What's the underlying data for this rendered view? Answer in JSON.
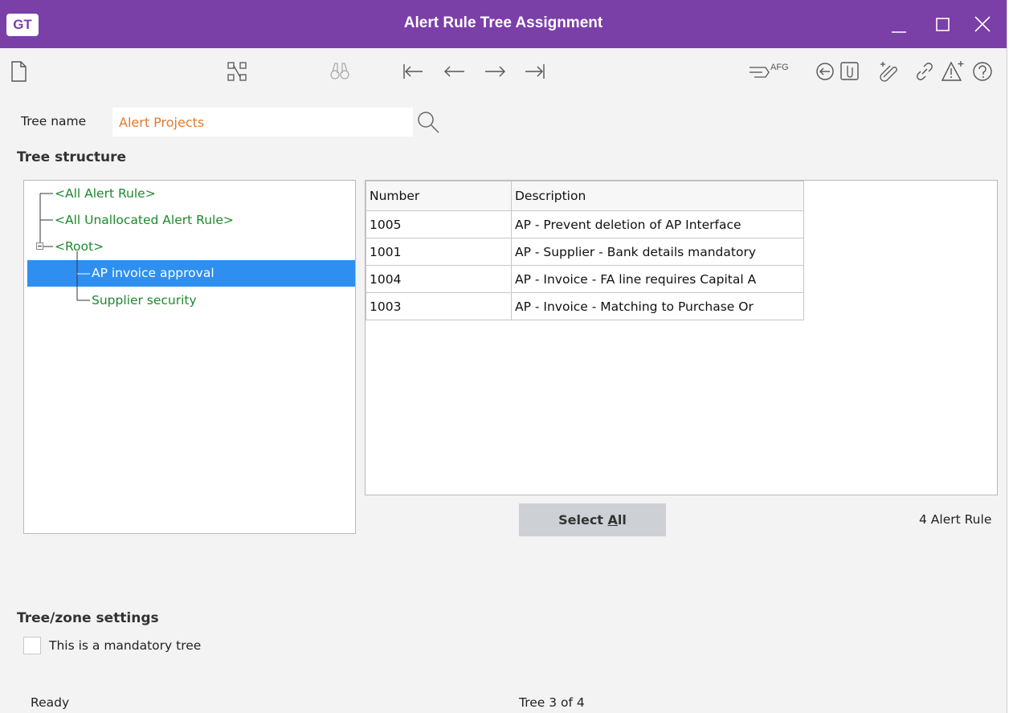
{
  "window": {
    "logo_text": "GT",
    "title": "Alert Rule Tree Assignment",
    "accent_color": "#7b3fa8"
  },
  "toolbar": {
    "left_icons": [
      "new-document-icon",
      "tree-structure-icon",
      "binoculars-icon",
      "first-record-icon",
      "previous-record-icon",
      "next-record-icon",
      "last-record-icon"
    ],
    "afg_label": "AFG",
    "right_icons": [
      "flag-pointer-icon",
      "afg-icon",
      "back-circle-icon",
      "attachment-folder-icon",
      "add-attachment-icon",
      "link-icon",
      "alert-add-icon",
      "help-icon"
    ]
  },
  "form": {
    "tree_name_label": "Tree name",
    "tree_name_value": "Alert Projects"
  },
  "tree_structure": {
    "heading": "Tree structure",
    "nodes": [
      {
        "label": "<All Alert Rule>"
      },
      {
        "label": "<All Unallocated Alert Rule>"
      },
      {
        "label": "<Root>"
      },
      {
        "label": "AP invoice approval",
        "selected": true
      },
      {
        "label": "Supplier security"
      }
    ],
    "node_color": "#1c8a2e",
    "selection_color": "#2f8ff0"
  },
  "grid": {
    "columns": [
      "Number",
      "Description"
    ],
    "rows": [
      {
        "number": "1005",
        "description": "AP - Prevent deletion of AP Interface"
      },
      {
        "number": "1001",
        "description": "AP - Supplier - Bank details mandatory"
      },
      {
        "number": "1004",
        "description": "AP - Invoice - FA line requires Capital A"
      },
      {
        "number": "1003",
        "description": "AP - Invoice - Matching to Purchase Or"
      }
    ]
  },
  "actions": {
    "select_all_prefix": "Select ",
    "select_all_hotkey": "A",
    "select_all_suffix": "ll",
    "count_label": "4 Alert Rule"
  },
  "settings": {
    "heading": "Tree/zone settings",
    "mandatory_label": "This is a mandatory tree",
    "mandatory_checked": false
  },
  "status": {
    "left": "Ready",
    "center": "Tree 3 of 4"
  }
}
